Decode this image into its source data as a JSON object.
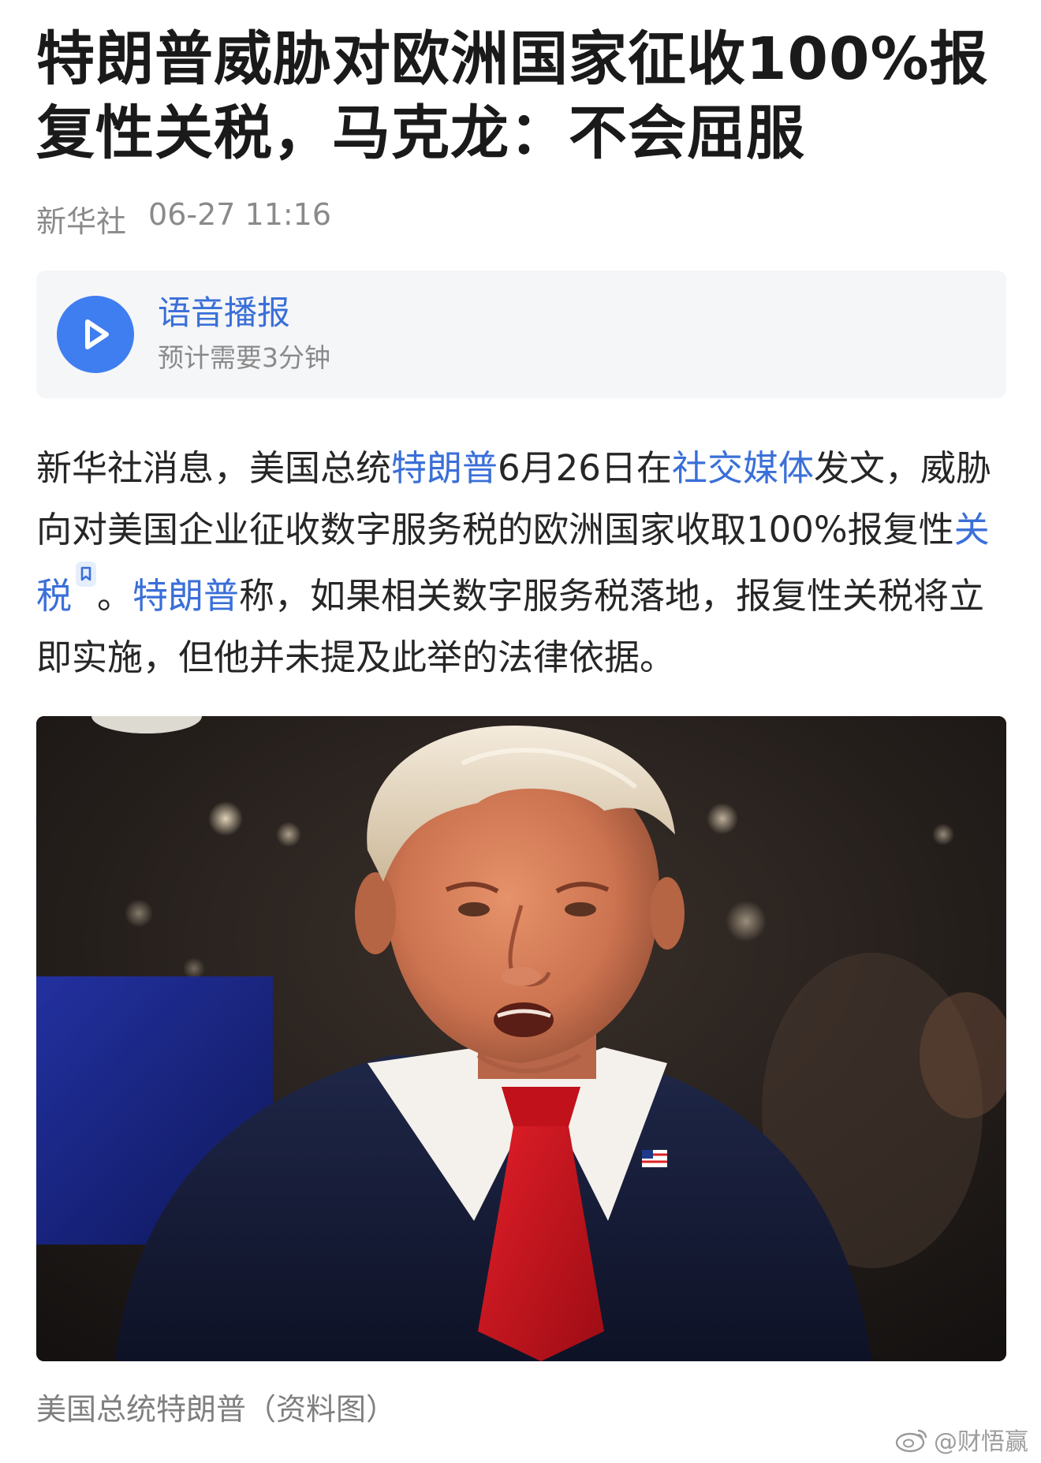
{
  "article": {
    "title": "特朗普威胁对欧洲国家征收100%报复性关税，马克龙：不会屈服",
    "source": "新华社",
    "time": "06-27 11:16"
  },
  "audio": {
    "title": "语音播报",
    "duration": "预计需要3分钟",
    "icon": "play-icon",
    "accent_color": "#3f7ef0"
  },
  "body": {
    "p1": "新华社消息，美国总统",
    "link1": "特朗普",
    "p2": "6月26日在",
    "link2": "社交媒体",
    "p3": "发文，威胁向对美国企业征收数字服务税的欧洲国家收取100%报复性",
    "link3": "关税",
    "p4": "。",
    "link4": "特朗普",
    "p5": "称，如果相关数字服务税落地，报复性关税将立即实施，但他并未提及此举的法律依据。"
  },
  "image": {
    "caption": "美国总统特朗普（资料图）"
  },
  "watermark": {
    "text": "@财悟赢",
    "icon": "weibo-icon"
  },
  "colors": {
    "link": "#3a6fd8",
    "meta": "#8a8a8a",
    "card_bg": "#f5f6f8"
  }
}
